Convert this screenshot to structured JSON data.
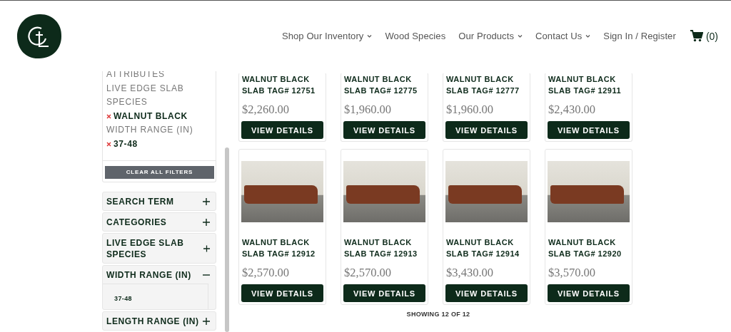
{
  "nav": {
    "items": [
      {
        "label": "Shop Our Inventory",
        "dropdown": true
      },
      {
        "label": "Wood Species",
        "dropdown": false
      },
      {
        "label": "Our Products",
        "dropdown": true
      },
      {
        "label": "Contact Us",
        "dropdown": true
      },
      {
        "label": "Sign In / Register",
        "dropdown": false
      }
    ],
    "cart_count": "(0)"
  },
  "sidebar": {
    "applied_filters": [
      {
        "kind": "heading",
        "label": "ATTRIBUTES"
      },
      {
        "kind": "heading",
        "label": "LIVE EDGE SLAB SPECIES"
      },
      {
        "kind": "value",
        "label": "WALNUT BLACK"
      },
      {
        "kind": "heading",
        "label": "WIDTH RANGE (IN)"
      },
      {
        "kind": "value",
        "label": "37-48"
      }
    ],
    "clear_button": "CLEAR ALL FILTERS",
    "sections": [
      {
        "title": "SEARCH TERM",
        "expanded": false
      },
      {
        "title": "CATEGORIES",
        "expanded": false
      },
      {
        "title": "LIVE EDGE SLAB SPECIES",
        "expanded": false
      },
      {
        "title": "WIDTH RANGE (IN)",
        "expanded": true,
        "options": [
          "37-48"
        ]
      },
      {
        "title": "LENGTH RANGE (IN)",
        "expanded": false
      }
    ]
  },
  "products": [
    {
      "title": "WALNUT BLACK SLAB TAG# 12751",
      "price": "$2,260.00",
      "image_shown": false,
      "button": "VIEW DETAILS"
    },
    {
      "title": "WALNUT BLACK SLAB TAG# 12775",
      "price": "$1,960.00",
      "image_shown": false,
      "button": "VIEW DETAILS"
    },
    {
      "title": "WALNUT BLACK SLAB TAG# 12777",
      "price": "$1,960.00",
      "image_shown": false,
      "button": "VIEW DETAILS"
    },
    {
      "title": "WALNUT BLACK SLAB TAG# 12911",
      "price": "$2,430.00",
      "image_shown": false,
      "button": "VIEW DETAILS"
    },
    {
      "title": "WALNUT BLACK SLAB TAG# 12912",
      "price": "$2,570.00",
      "image_shown": true,
      "button": "VIEW DETAILS"
    },
    {
      "title": "WALNUT BLACK SLAB TAG# 12913",
      "price": "$2,570.00",
      "image_shown": true,
      "button": "VIEW DETAILS"
    },
    {
      "title": "WALNUT BLACK SLAB TAG# 12914",
      "price": "$3,430.00",
      "image_shown": true,
      "button": "VIEW DETAILS"
    },
    {
      "title": "WALNUT BLACK SLAB TAG# 12920",
      "price": "$3,570.00",
      "image_shown": true,
      "button": "VIEW DETAILS"
    }
  ],
  "results_count": "SHOWING 12 OF 12"
}
